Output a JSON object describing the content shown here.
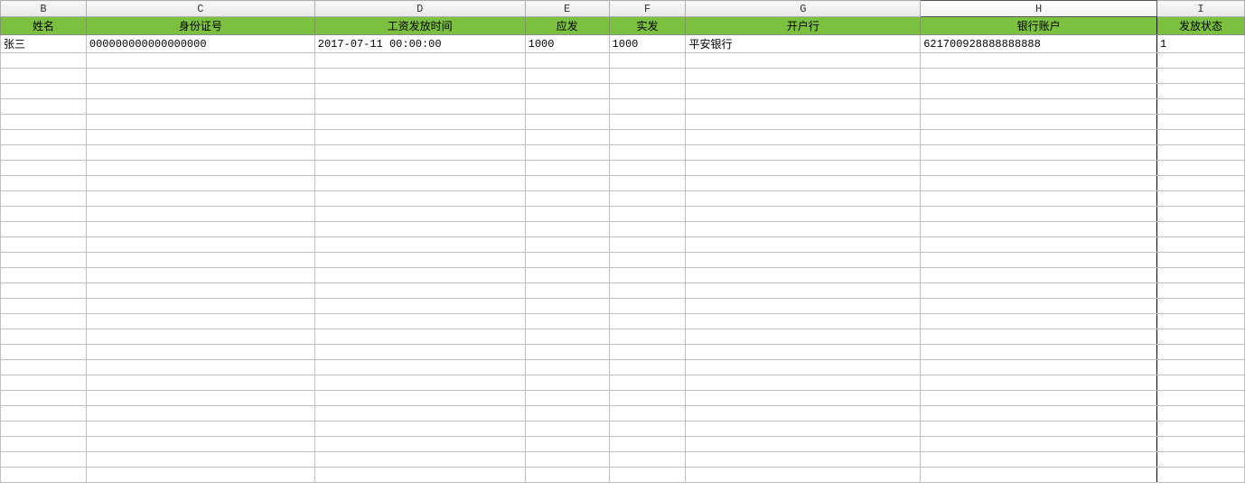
{
  "columns": [
    {
      "letter": "B",
      "header": "姓名",
      "selected": false
    },
    {
      "letter": "C",
      "header": "身份证号",
      "selected": false
    },
    {
      "letter": "D",
      "header": "工资发放时间",
      "selected": false
    },
    {
      "letter": "E",
      "header": "应发",
      "selected": false
    },
    {
      "letter": "F",
      "header": "实发",
      "selected": false
    },
    {
      "letter": "G",
      "header": "开户行",
      "selected": false
    },
    {
      "letter": "H",
      "header": "银行账户",
      "selected": true
    },
    {
      "letter": "I",
      "header": "发放状态",
      "selected": false
    }
  ],
  "data_rows": [
    {
      "B": "张三",
      "C": "000000000000000000",
      "D": "2017-07-11 00:00:00",
      "E": "1000",
      "F": "1000",
      "G": "平安银行",
      "H": "621700928888888888",
      "I": "1"
    }
  ],
  "empty_row_count": 28
}
